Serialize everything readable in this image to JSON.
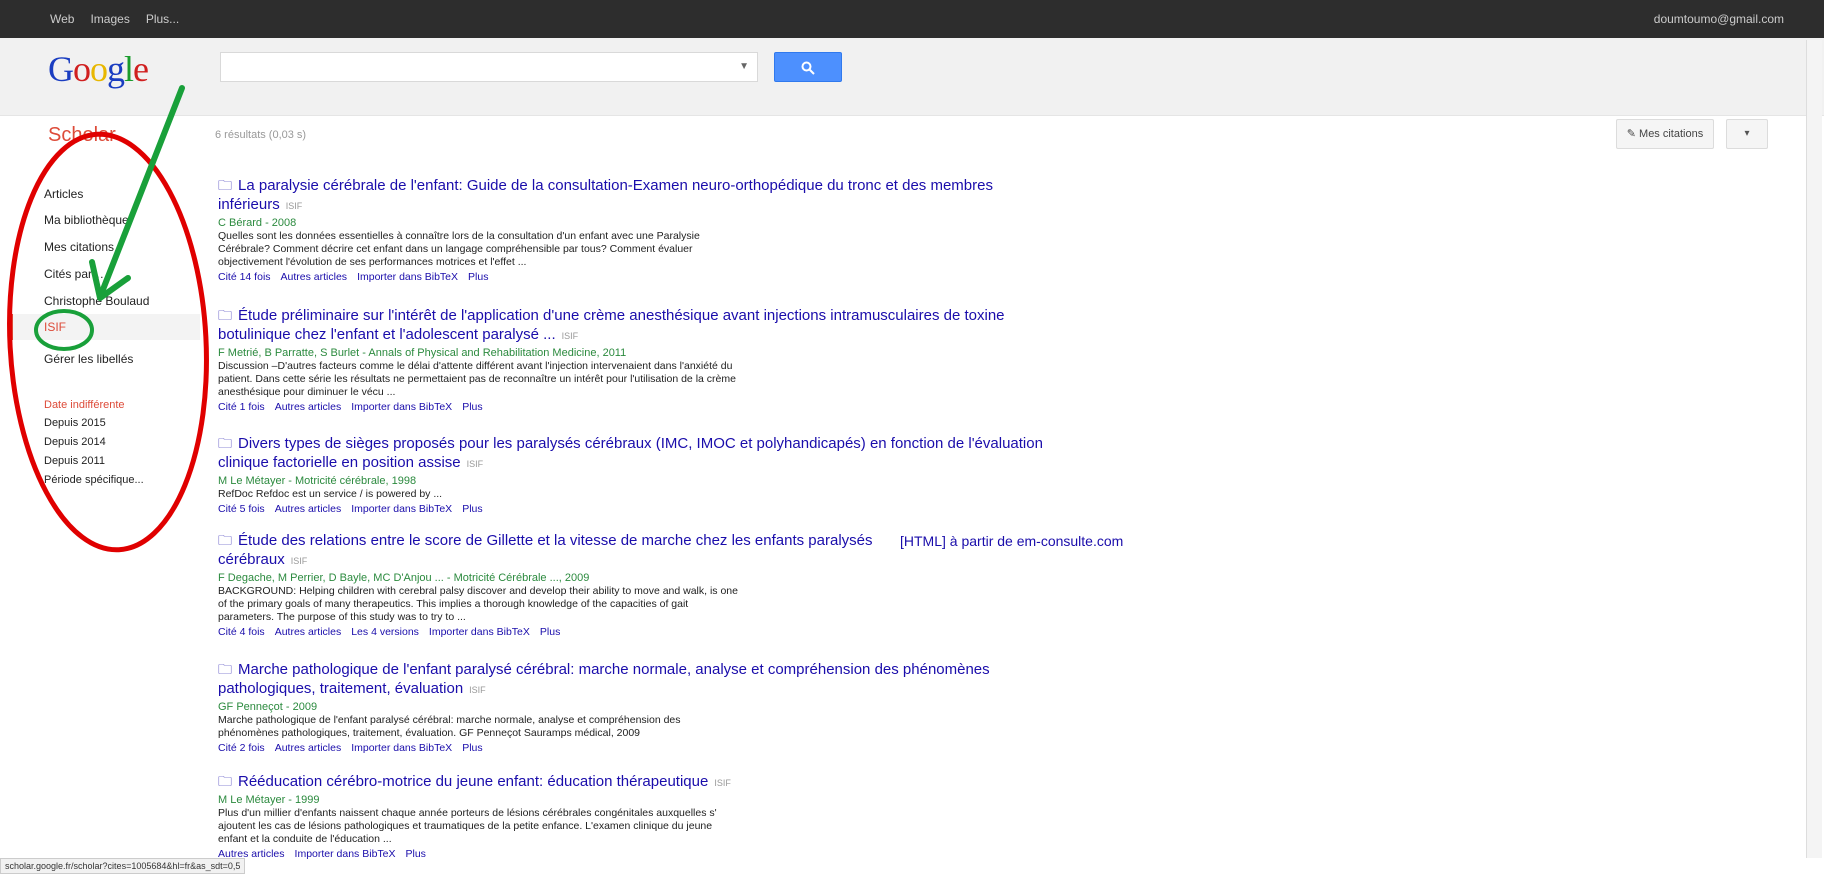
{
  "topbar": {
    "links": [
      "Web",
      "Images",
      "Plus..."
    ],
    "account": "doumtoumo@gmail.com"
  },
  "header": {
    "logo": "Google",
    "search_value": "",
    "search_icon": "search-icon"
  },
  "subhead": {
    "scholar": "Scholar",
    "result_count": "6 résultats (0,03 s)",
    "my_citations": "Mes citations",
    "more": "▾"
  },
  "sidebar": {
    "items": [
      "Articles",
      "Ma bibliothèque",
      "Mes citations",
      "Cités par…",
      "Christophe Boulaud",
      "ISIF",
      "Gérer les libellés"
    ],
    "date_header": "Date indifférente",
    "dates": [
      "Depuis 2015",
      "Depuis 2014",
      "Depuis 2011",
      "Période spécifique..."
    ]
  },
  "results": [
    {
      "title": "La paralysie cérébrale de l'enfant: Guide de la consultation-Examen neuro-orthopédique du tronc et des membres inférieurs",
      "pdf": "ISIF",
      "authors": "C Bérard - 2008",
      "snippet": "Quelles sont les données essentielles à connaître lors de la consultation d'un enfant avec une Paralysie Cérébrale? Comment décrire cet enfant dans un langage compréhensible par tous? Comment évaluer objectivement l'évolution de ses performances motrices et l'effet ...",
      "links": [
        "Cité 14 fois",
        "Autres articles",
        "Importer dans BibTeX",
        "Plus"
      ]
    },
    {
      "title": "Étude préliminaire sur l'intérêt de l'application d'une crème anesthésique avant injections intramusculaires de toxine botulinique chez l'enfant et l'adolescent paralysé ...",
      "pdf": "ISIF",
      "authors": "F Metrié, B Parratte, S Burlet - Annals of Physical and Rehabilitation Medicine, 2011",
      "snippet": "Discussion –D'autres facteurs comme le délai d'attente différent avant l'injection intervenaient dans l'anxiété du patient. Dans cette série les résultats ne permettaient pas de reconnaître un intérêt pour l'utilisation de la crème anesthésique pour diminuer le vécu ...",
      "links": [
        "Cité 1 fois",
        "Autres articles",
        "Importer dans BibTeX",
        "Plus"
      ]
    },
    {
      "title": "Divers types de sièges proposés pour les paralysés cérébraux (IMC, IMOC et polyhandicapés) en fonction de l'évaluation clinique factorielle en position assise",
      "pdf": "ISIF",
      "authors": "M Le Métayer - Motricité cérébrale, 1998",
      "snippet": "RefDoc Refdoc est un service / is powered by ...",
      "links": [
        "Cité 5 fois",
        "Autres articles",
        "Importer dans BibTeX",
        "Plus"
      ]
    },
    {
      "title": "Étude des relations entre le score de Gillette et la vitesse de marche chez les enfants paralysés cérébraux",
      "pdf": "ISIF",
      "authors": "F Degache, M Perrier, D Bayle, MC D'Anjou ... - Motricité Cérébrale ..., 2009",
      "snippet": "BACKGROUND: Helping children with cerebral palsy discover and develop their ability to move and walk, is one of the primary goals of many therapeutics. This implies a thorough knowledge of the capacities of gait parameters. The purpose of this study was to try to ...",
      "links": [
        "Cité 4 fois",
        "Autres articles",
        "Les 4 versions",
        "Importer dans BibTeX",
        "Plus"
      ]
    },
    {
      "title": "Marche pathologique de l'enfant paralysé cérébral: marche normale, analyse et compréhension des phénomènes pathologiques, traitement, évaluation",
      "pdf": "ISIF",
      "authors": "GF Penneçot - 2009",
      "snippet": "Marche pathologique de l'enfant paralysé cérébral: marche normale, analyse et compréhension des phénomènes pathologiques, traitement, évaluation. GF Penneçot Sauramps médical, 2009",
      "links": [
        "Cité 2 fois",
        "Autres articles",
        "Importer dans BibTeX",
        "Plus"
      ]
    },
    {
      "title": "Rééducation cérébro-motrice du jeune enfant: éducation thérapeutique",
      "pdf": "ISIF",
      "authors": "M Le Métayer - 1999",
      "snippet": "Plus d'un millier d'enfants naissent chaque année porteurs de lésions cérébrales congénitales auxquelles s' ajoutent les cas de lésions pathologiques et traumatiques de la petite enfance. L'examen clinique du jeune enfant et la conduite de l'éducation ...",
      "links": [
        "Autres articles",
        "Importer dans BibTeX",
        "Plus"
      ]
    }
  ],
  "side_link": "[HTML] à partir de em-consulte.com",
  "statusbar": "scholar.google.fr/scholar?cites=1005684&hl=fr&as_sdt=0,5",
  "colors": {
    "accent": "#dd4b39",
    "link": "#1a0dab",
    "annotation_red": "#e00000",
    "annotation_green": "#19a03a"
  }
}
